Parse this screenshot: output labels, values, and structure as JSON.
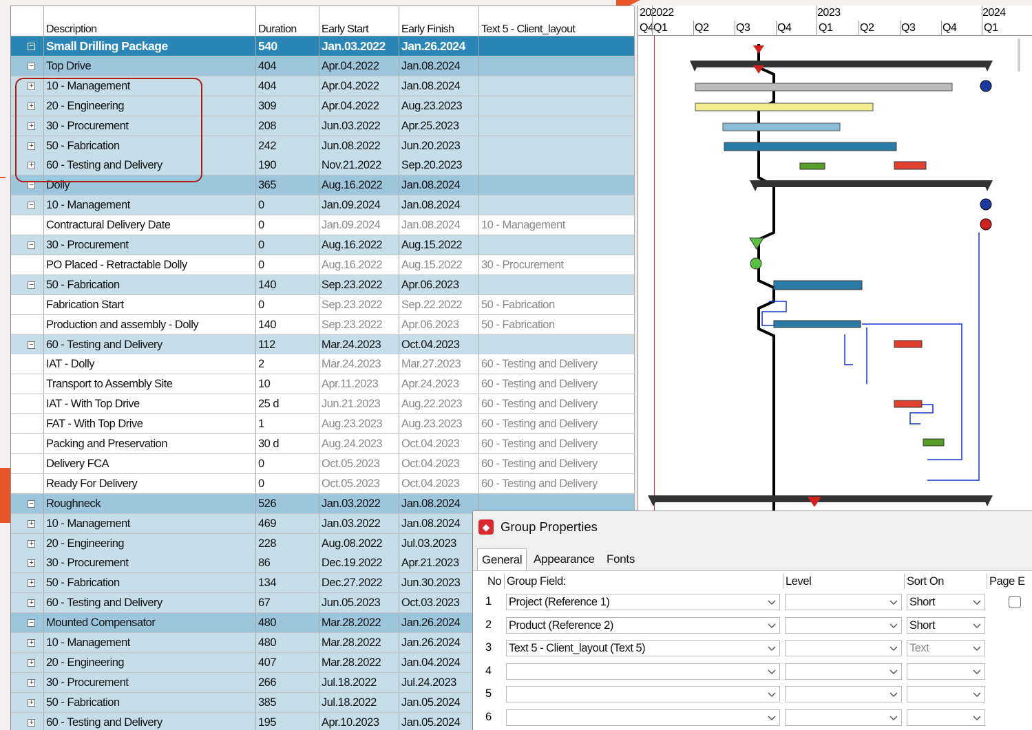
{
  "columns": {
    "description": "Description",
    "duration": "Duration",
    "early_start": "Early Start",
    "early_finish": "Early Finish",
    "text5": "Text 5 - Client_layout"
  },
  "rows": [
    {
      "level": "top",
      "toggle": "−",
      "desc": "Small Drilling Package",
      "dur": "540",
      "es": "Jan.03.2022",
      "ef": "Jan.26.2024",
      "t5": ""
    },
    {
      "level": "g1",
      "toggle": "−",
      "desc": "Top Drive",
      "dur": "404",
      "es": "Apr.04.2022",
      "ef": "Jan.08.2024",
      "t5": ""
    },
    {
      "level": "g2",
      "toggle": "+",
      "desc": "10 - Management",
      "dur": "404",
      "es": "Apr.04.2022",
      "ef": "Jan.08.2024",
      "t5": ""
    },
    {
      "level": "g2",
      "toggle": "+",
      "desc": "20 - Engineering",
      "dur": "309",
      "es": "Apr.04.2022",
      "ef": "Aug.23.2023",
      "t5": ""
    },
    {
      "level": "g2",
      "toggle": "+",
      "desc": "30 - Procurement",
      "dur": "208",
      "es": "Jun.03.2022",
      "ef": "Apr.25.2023",
      "t5": ""
    },
    {
      "level": "g2",
      "toggle": "+",
      "desc": "50 - Fabrication",
      "dur": "242",
      "es": "Jun.08.2022",
      "ef": "Jun.20.2023",
      "t5": ""
    },
    {
      "level": "g2",
      "toggle": "+",
      "desc": "60 - Testing and Delivery",
      "dur": "190",
      "es": "Nov.21.2022",
      "ef": "Sep.20.2023",
      "t5": ""
    },
    {
      "level": "g1",
      "toggle": "−",
      "desc": "Dolly",
      "dur": "365",
      "es": "Aug.16.2022",
      "ef": "Jan.08.2024",
      "t5": ""
    },
    {
      "level": "g2",
      "toggle": "−",
      "desc": "10 - Management",
      "dur": "0",
      "es": "Jan.09.2024",
      "ef": "Jan.08.2024",
      "t5": ""
    },
    {
      "level": "task",
      "toggle": "",
      "desc": "Contractural Delivery Date",
      "dur": "0",
      "es": "Jan.09.2024",
      "ef": "Jan.08.2024",
      "t5": "10 - Management"
    },
    {
      "level": "g2",
      "toggle": "−",
      "desc": "30 - Procurement",
      "dur": "0",
      "es": "Aug.16.2022",
      "ef": "Aug.15.2022",
      "t5": ""
    },
    {
      "level": "task",
      "toggle": "",
      "desc": "PO Placed - Retractable Dolly",
      "dur": "0",
      "es": "Aug.16.2022",
      "ef": "Aug.15.2022",
      "t5": "30 - Procurement"
    },
    {
      "level": "g2",
      "toggle": "−",
      "desc": "50 - Fabrication",
      "dur": "140",
      "es": "Sep.23.2022",
      "ef": "Apr.06.2023",
      "t5": ""
    },
    {
      "level": "task",
      "toggle": "",
      "desc": "Fabrication Start",
      "dur": "0",
      "es": "Sep.23.2022",
      "ef": "Sep.22.2022",
      "t5": "50 - Fabrication"
    },
    {
      "level": "task",
      "toggle": "",
      "desc": "Production and assembly - Dolly",
      "dur": "140",
      "es": "Sep.23.2022",
      "ef": "Apr.06.2023",
      "t5": "50 - Fabrication"
    },
    {
      "level": "g2",
      "toggle": "−",
      "desc": "60 - Testing and Delivery",
      "dur": "112",
      "es": "Mar.24.2023",
      "ef": "Oct.04.2023",
      "t5": ""
    },
    {
      "level": "task",
      "toggle": "",
      "desc": "IAT - Dolly",
      "dur": "2",
      "es": "Mar.24.2023",
      "ef": "Mar.27.2023",
      "t5": "60 - Testing and Delivery"
    },
    {
      "level": "task",
      "toggle": "",
      "desc": "Transport to Assembly Site",
      "dur": "10",
      "es": "Apr.11.2023",
      "ef": "Apr.24.2023",
      "t5": "60 - Testing and Delivery"
    },
    {
      "level": "task",
      "toggle": "",
      "desc": "IAT - With Top Drive",
      "dur": "25 d",
      "es": "Jun.21.2023",
      "ef": "Aug.22.2023",
      "t5": "60 - Testing and Delivery"
    },
    {
      "level": "task",
      "toggle": "",
      "desc": "FAT - With Top Drive",
      "dur": "1",
      "es": "Aug.23.2023",
      "ef": "Aug.23.2023",
      "t5": "60 - Testing and Delivery"
    },
    {
      "level": "task",
      "toggle": "",
      "desc": "Packing and Preservation",
      "dur": "30 d",
      "es": "Aug.24.2023",
      "ef": "Oct.04.2023",
      "t5": "60 - Testing and Delivery"
    },
    {
      "level": "task",
      "toggle": "",
      "desc": "Delivery FCA",
      "dur": "0",
      "es": "Oct.05.2023",
      "ef": "Oct.04.2023",
      "t5": "60 - Testing and Delivery"
    },
    {
      "level": "task",
      "toggle": "",
      "desc": "Ready For Delivery",
      "dur": "0",
      "es": "Oct.05.2023",
      "ef": "Oct.04.2023",
      "t5": "60 - Testing and Delivery"
    },
    {
      "level": "g1",
      "toggle": "−",
      "desc": "Roughneck",
      "dur": "526",
      "es": "Jan.03.2022",
      "ef": "Jan.08.2024",
      "t5": ""
    },
    {
      "level": "g2",
      "toggle": "+",
      "desc": "10 - Management",
      "dur": "469",
      "es": "Jan.03.2022",
      "ef": "Jan.08.2024",
      "t5": ""
    },
    {
      "level": "g2",
      "toggle": "+",
      "desc": "20 - Engineering",
      "dur": "228",
      "es": "Aug.08.2022",
      "ef": "Jul.03.2023",
      "t5": ""
    },
    {
      "level": "g2",
      "toggle": "+",
      "desc": "30 - Procurement",
      "dur": "86",
      "es": "Dec.19.2022",
      "ef": "Apr.21.2023",
      "t5": ""
    },
    {
      "level": "g2",
      "toggle": "+",
      "desc": "50 - Fabrication",
      "dur": "134",
      "es": "Dec.27.2022",
      "ef": "Jun.30.2023",
      "t5": ""
    },
    {
      "level": "g2",
      "toggle": "+",
      "desc": "60 - Testing and Delivery",
      "dur": "67",
      "es": "Jun.05.2023",
      "ef": "Oct.03.2023",
      "t5": ""
    },
    {
      "level": "g1",
      "toggle": "−",
      "desc": "Mounted Compensator",
      "dur": "480",
      "es": "Mar.28.2022",
      "ef": "Jan.26.2024",
      "t5": ""
    },
    {
      "level": "g2",
      "toggle": "+",
      "desc": "10 - Management",
      "dur": "480",
      "es": "Mar.28.2022",
      "ef": "Jan.26.2024",
      "t5": ""
    },
    {
      "level": "g2",
      "toggle": "+",
      "desc": "20 - Engineering",
      "dur": "407",
      "es": "Mar.28.2022",
      "ef": "Jan.04.2024",
      "t5": ""
    },
    {
      "level": "g2",
      "toggle": "+",
      "desc": "30 - Procurement",
      "dur": "266",
      "es": "Jul.18.2022",
      "ef": "Jul.24.2023",
      "t5": ""
    },
    {
      "level": "g2",
      "toggle": "+",
      "desc": "50 - Fabrication",
      "dur": "385",
      "es": "Jul.18.2022",
      "ef": "Jan.05.2024",
      "t5": ""
    },
    {
      "level": "g2",
      "toggle": "+",
      "desc": "60 - Testing and Delivery",
      "dur": "195",
      "es": "Apr.10.2023",
      "ef": "Jan.05.2024",
      "t5": ""
    }
  ],
  "gantt": {
    "years": [
      "20",
      "2022",
      "2023",
      "2024"
    ],
    "quarters": [
      "Q4",
      "Q1",
      "Q2",
      "Q3",
      "Q4",
      "Q1",
      "Q2",
      "Q3",
      "Q4",
      "Q1"
    ]
  },
  "dialog": {
    "title": "Group Properties",
    "tabs": [
      "General",
      "Appearance",
      "Fonts"
    ],
    "headers": {
      "no": "No",
      "field": "Group Field:",
      "level": "Level",
      "sort": "Sort On",
      "page": "Page E"
    },
    "rows": [
      {
        "no": "1",
        "field": "Project (Reference 1)",
        "level": "",
        "sort": "Short",
        "sort_dim": false
      },
      {
        "no": "2",
        "field": "Product (Reference 2)",
        "level": "",
        "sort": "Short",
        "sort_dim": false
      },
      {
        "no": "3",
        "field": "Text 5 - Client_layout (Text 5)",
        "level": "",
        "sort": "Text",
        "sort_dim": true
      },
      {
        "no": "4",
        "field": "",
        "level": "",
        "sort": "",
        "sort_dim": false
      },
      {
        "no": "5",
        "field": "",
        "level": "",
        "sort": "",
        "sort_dim": false
      },
      {
        "no": "6",
        "field": "",
        "level": "",
        "sort": "",
        "sort_dim": false
      }
    ]
  },
  "colors": {
    "top_row": "#2b86b8",
    "group1": "#9cc6dc",
    "group2": "#c7dde8",
    "accent_orange": "#e8562a",
    "highlight": "#b01c1c"
  }
}
